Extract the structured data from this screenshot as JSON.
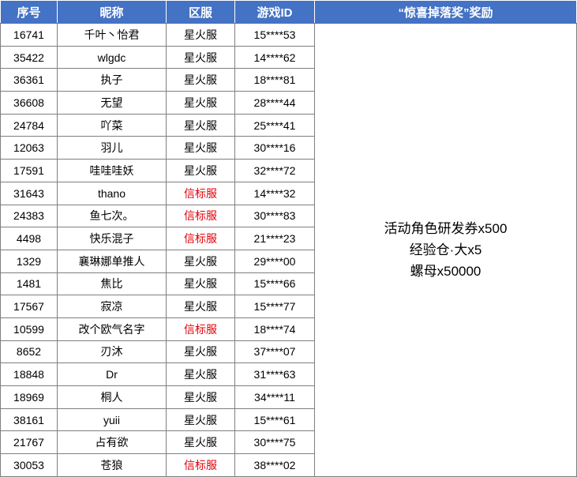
{
  "headers": [
    "序号",
    "昵称",
    "区服",
    "游戏ID",
    "“惊喜掉落奖”奖励"
  ],
  "rows": [
    {
      "num": "16741",
      "name": "千叶丶怡君",
      "server": "星火服",
      "id": "15****53"
    },
    {
      "num": "35422",
      "name": "wlgdc",
      "server": "星火服",
      "id": "14****62"
    },
    {
      "num": "36361",
      "name": "执子",
      "server": "星火服",
      "id": "18****81"
    },
    {
      "num": "36608",
      "name": "无望",
      "server": "星火服",
      "id": "28****44"
    },
    {
      "num": "24784",
      "name": "吖菜",
      "server": "星火服",
      "id": "25****41"
    },
    {
      "num": "12063",
      "name": "羽儿",
      "server": "星火服",
      "id": "30****16"
    },
    {
      "num": "17591",
      "name": "哇哇哇妖",
      "server": "星火服",
      "id": "32****72"
    },
    {
      "num": "31643",
      "name": "thano",
      "server": "信标服",
      "id": "14****32"
    },
    {
      "num": "24383",
      "name": "鱼七次。",
      "server": "信标服",
      "id": "30****83"
    },
    {
      "num": "4498",
      "name": "快乐混子",
      "server": "信标服",
      "id": "21****23"
    },
    {
      "num": "1329",
      "name": "襄琳娜单推人",
      "server": "星火服",
      "id": "29****00"
    },
    {
      "num": "1481",
      "name": "焦比",
      "server": "星火服",
      "id": "15****66"
    },
    {
      "num": "17567",
      "name": "寂凉",
      "server": "星火服",
      "id": "15****77"
    },
    {
      "num": "10599",
      "name": "改个欧气名字",
      "server": "信标服",
      "id": "18****74"
    },
    {
      "num": "8652",
      "name": "刃沐",
      "server": "星火服",
      "id": "37****07"
    },
    {
      "num": "18848",
      "name": "Dr",
      "server": "星火服",
      "id": "31****63"
    },
    {
      "num": "18969",
      "name": "桐人",
      "server": "星火服",
      "id": "34****11"
    },
    {
      "num": "38161",
      "name": "yuii",
      "server": "星火服",
      "id": "15****61"
    },
    {
      "num": "21767",
      "name": "占有欲",
      "server": "星火服",
      "id": "30****75"
    },
    {
      "num": "30053",
      "name": "苍狼",
      "server": "信标服",
      "id": "38****02"
    }
  ],
  "reward_lines": [
    "活动角色研发券x500",
    "经验仓·大x5",
    "螺母x50000"
  ],
  "colors": {
    "header_bg": "#4472c4",
    "header_text": "#ffffff",
    "server_xinbiao": "#e0000a",
    "server_xinghuo": "#000000"
  }
}
